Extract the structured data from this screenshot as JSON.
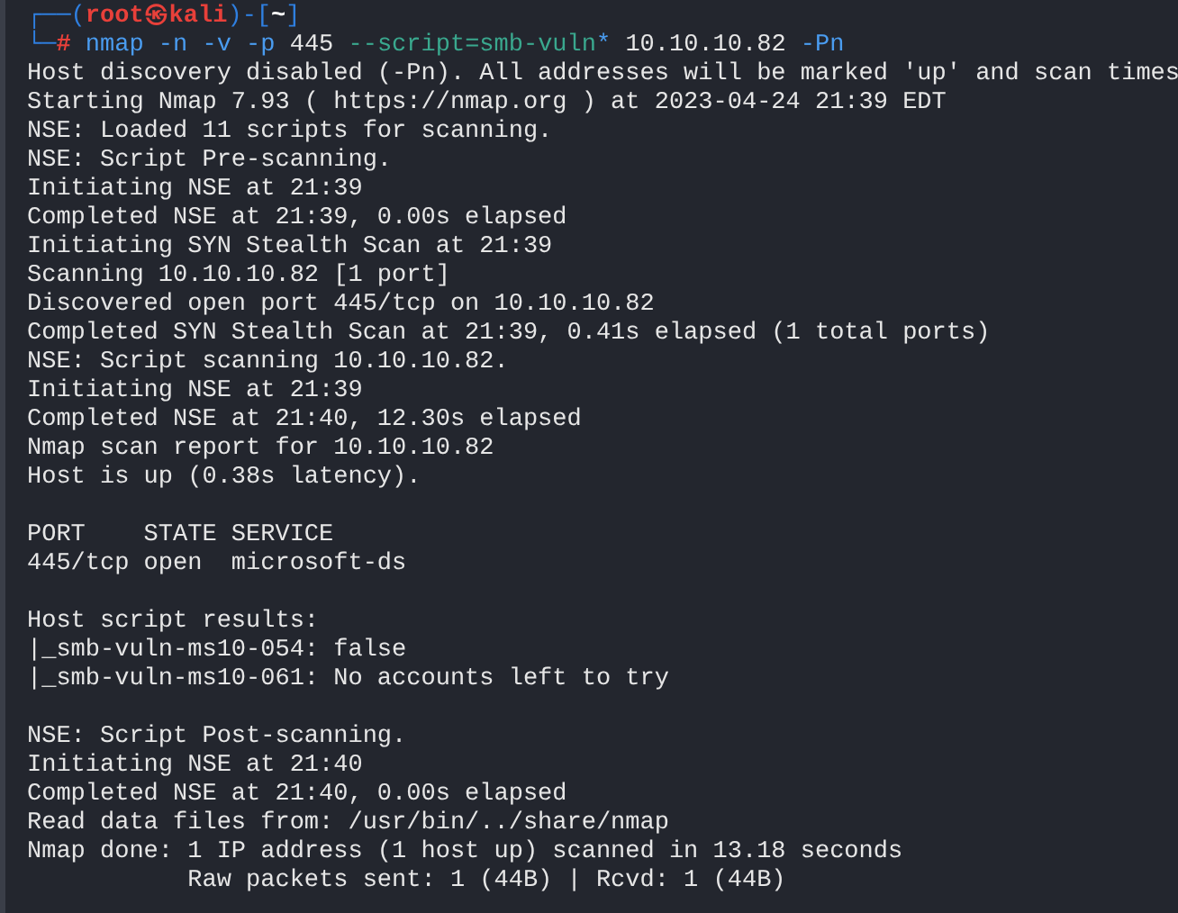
{
  "prompt": {
    "line1": [
      {
        "kind": "frame",
        "text": "┌──("
      },
      {
        "kind": "user",
        "text": "root㉿kali"
      },
      {
        "kind": "frame",
        "text": ")-["
      },
      {
        "kind": "path",
        "text": "~"
      },
      {
        "kind": "frame",
        "text": "]"
      }
    ],
    "line2": [
      {
        "kind": "frame",
        "text": "└─"
      },
      {
        "kind": "hash",
        "text": "#"
      },
      {
        "kind": "command",
        "text": " nmap"
      },
      {
        "kind": "option",
        "text": " -n -v -p"
      },
      {
        "kind": "plain",
        "text": " 445"
      },
      {
        "kind": "string",
        "text": " --script=smb-vuln"
      },
      {
        "kind": "command",
        "text": "*"
      },
      {
        "kind": "plain",
        "text": " 10.10.10.82"
      },
      {
        "kind": "option",
        "text": " -Pn"
      }
    ]
  },
  "output_blocks": [
    [
      "Host discovery disabled (-Pn). All addresses will be marked 'up' and scan times",
      "Starting Nmap 7.93 ( https://nmap.org ) at 2023-04-24 21:39 EDT",
      "NSE: Loaded 11 scripts for scanning.",
      "NSE: Script Pre-scanning.",
      "Initiating NSE at 21:39",
      "Completed NSE at 21:39, 0.00s elapsed",
      "Initiating SYN Stealth Scan at 21:39",
      "Scanning 10.10.10.82 [1 port]",
      "Discovered open port 445/tcp on 10.10.10.82",
      "Completed SYN Stealth Scan at 21:39, 0.41s elapsed (1 total ports)",
      "NSE: Script scanning 10.10.10.82.",
      "Initiating NSE at 21:39",
      "Completed NSE at 21:40, 12.30s elapsed",
      "Nmap scan report for 10.10.10.82",
      "Host is up (0.38s latency)."
    ],
    [
      "PORT    STATE SERVICE",
      "445/tcp open  microsoft-ds"
    ],
    [
      "Host script results:",
      "|_smb-vuln-ms10-054: false",
      "|_smb-vuln-ms10-061: No accounts left to try"
    ],
    [
      "NSE: Script Post-scanning.",
      "Initiating NSE at 21:40",
      "Completed NSE at 21:40, 0.00s elapsed",
      "Read data files from: /usr/bin/../share/nmap",
      "Nmap done: 1 IP address (1 host up) scanned in 13.18 seconds",
      "           Raw packets sent: 1 (44B) | Rcvd: 1 (44B)"
    ]
  ]
}
